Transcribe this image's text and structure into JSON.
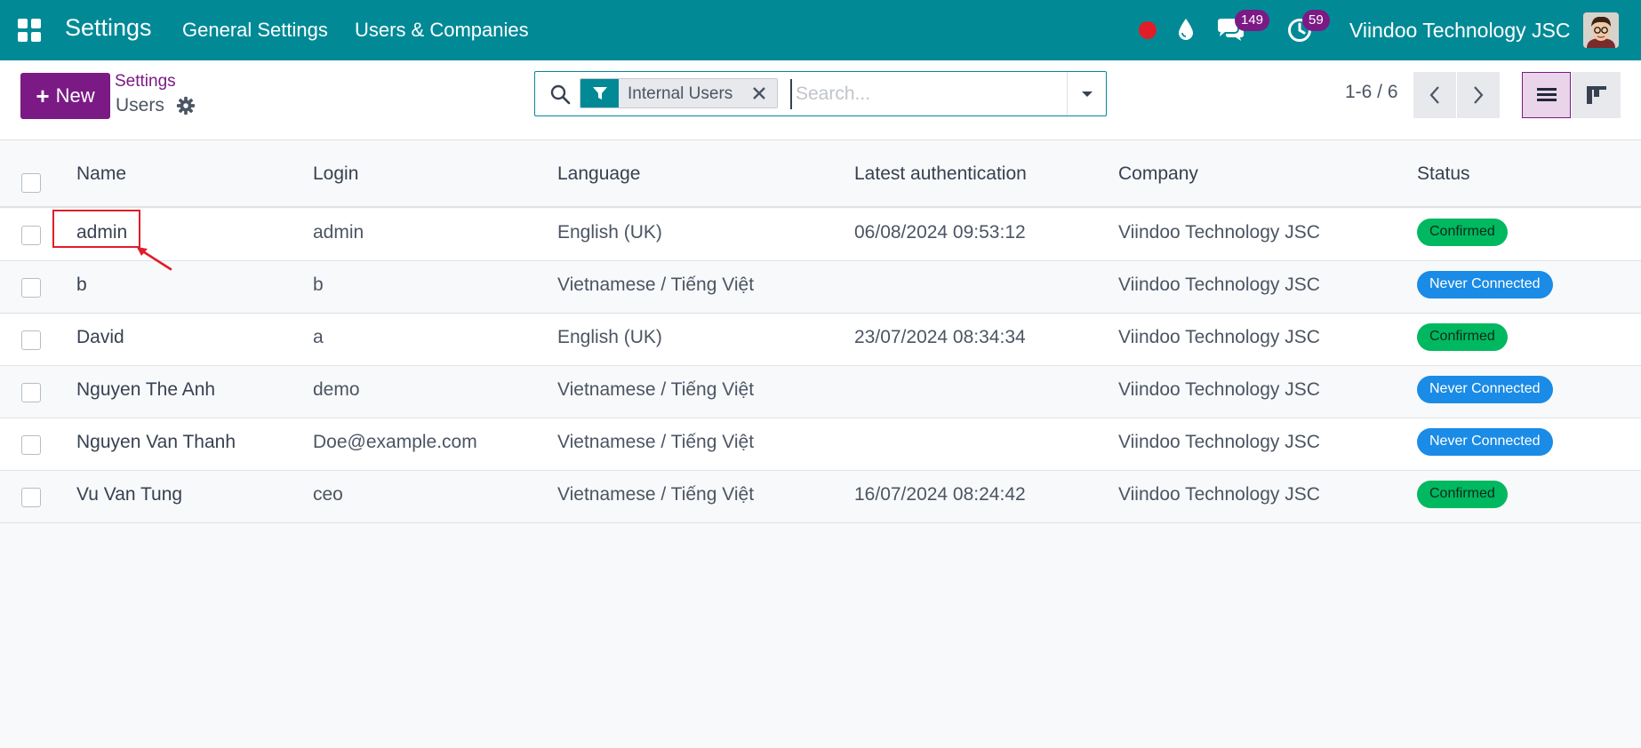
{
  "navbar": {
    "app_title": "Settings",
    "menu": [
      "General Settings",
      "Users & Companies"
    ],
    "chat_count": "149",
    "activity_count": "59",
    "company": "Viindoo Technology JSC",
    "colors": {
      "bar": "#018a96",
      "badge": "#7b1a85",
      "record": "#e11d2a"
    }
  },
  "control": {
    "new_label": "New",
    "breadcrumb_parent": "Settings",
    "breadcrumb_current": "Users",
    "facet_label": "Internal Users",
    "search_placeholder": "Search...",
    "pager": "1-6 / 6"
  },
  "table": {
    "columns": [
      "Name",
      "Login",
      "Language",
      "Latest authentication",
      "Company",
      "Status"
    ],
    "rows": [
      {
        "name": "admin",
        "login": "admin",
        "language": "English (UK)",
        "latest_auth": "06/08/2024 09:53:12",
        "company": "Viindoo Technology JSC",
        "status": "Confirmed"
      },
      {
        "name": "b",
        "login": "b",
        "language": "Vietnamese / Tiếng Việt",
        "latest_auth": "",
        "company": "Viindoo Technology JSC",
        "status": "Never Connected"
      },
      {
        "name": "David",
        "login": "a",
        "language": "English (UK)",
        "latest_auth": "23/07/2024 08:34:34",
        "company": "Viindoo Technology JSC",
        "status": "Confirmed"
      },
      {
        "name": "Nguyen The Anh",
        "login": "demo",
        "language": "Vietnamese / Tiếng Việt",
        "latest_auth": "",
        "company": "Viindoo Technology JSC",
        "status": "Never Connected"
      },
      {
        "name": "Nguyen Van Thanh",
        "login": "Doe@example.com",
        "language": "Vietnamese / Tiếng Việt",
        "latest_auth": "",
        "company": "Viindoo Technology JSC",
        "status": "Never Connected"
      },
      {
        "name": "Vu Van Tung",
        "login": "ceo",
        "language": "Vietnamese / Tiếng Việt",
        "latest_auth": "16/07/2024 08:24:42",
        "company": "Viindoo Technology JSC",
        "status": "Confirmed"
      }
    ]
  },
  "icons": {
    "apps": "apps-grid-icon",
    "record": "record-dot-icon",
    "drop": "drop-icon",
    "chat": "chat-icon",
    "activity": "clock-icon",
    "gear": "gear-icon",
    "search": "search-icon",
    "filter": "filter-icon",
    "close": "close-icon",
    "caret": "caret-down-icon",
    "prev": "chevron-left-icon",
    "next": "chevron-right-icon",
    "list_view": "list-view-icon",
    "kanban_view": "kanban-view-icon"
  },
  "annotation": {
    "highlight_color": "#e11d2a",
    "target": "admin"
  }
}
